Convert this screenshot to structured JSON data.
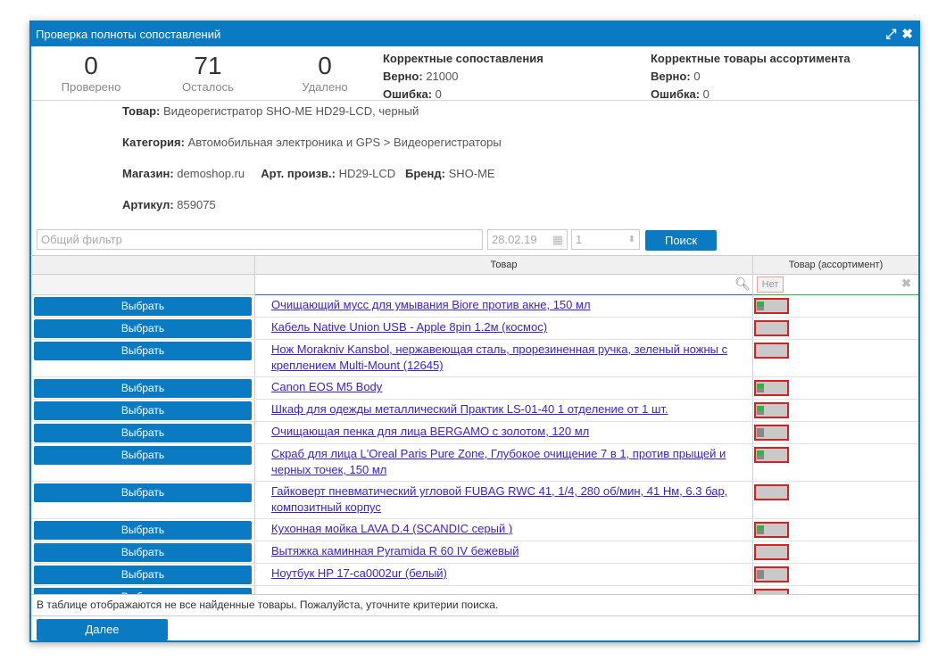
{
  "title": "Проверка полноты сопоставлений",
  "stats": [
    {
      "value": "0",
      "label": "Проверено"
    },
    {
      "value": "71",
      "label": "Осталось"
    },
    {
      "value": "0",
      "label": "Удалено"
    }
  ],
  "correct_matches": {
    "title": "Корректные сопоставления",
    "ok_label": "Верно:",
    "ok_value": "21000",
    "err_label": "Ошибка:",
    "err_value": "0"
  },
  "correct_assort": {
    "title": "Корректные товары ассортимента",
    "ok_label": "Верно:",
    "ok_value": "0",
    "err_label": "Ошибка:",
    "err_value": "0"
  },
  "product": {
    "label": "Товар:",
    "value": "Видеорегистратор SHO-ME HD29-LCD, черный",
    "category_label": "Категория:",
    "category_value": "Автомобильная электроника и GPS > Видеорегистраторы",
    "shop_label": "Магазин:",
    "shop_value": "demoshop.ru",
    "art_label": "Арт. произв.:",
    "art_value": "HD29-LCD",
    "brand_label": "Бренд:",
    "brand_value": "SHO-ME",
    "sku_label": "Артикул:",
    "sku_value": "859075"
  },
  "filter": {
    "placeholder": "Общий фильтр",
    "date": "28.02.19",
    "number": "1",
    "search_label": "Поиск"
  },
  "grid": {
    "col_product": "Товар",
    "col_assort": "Товар (ассортимент)",
    "assort_filter": "Нет",
    "select_label": "Выбрать",
    "rows": [
      {
        "name": "Очищающий мусс для умывания Biore против акне, 150 мл",
        "state": "green"
      },
      {
        "name": "Кабель Native Union USB - Apple 8pin 1.2м (космос)",
        "state": "none"
      },
      {
        "name": "Нож Morakniv Kansbol, нержавеющая сталь, прорезиненная ручка, зеленый ножны с креплением Multi-Mount (12645)",
        "state": "none"
      },
      {
        "name": "Canon EOS M5 Body",
        "state": "green"
      },
      {
        "name": "Шкаф для одежды металлический Практик LS-01-40 1 отделение от 1 шт.",
        "state": "green"
      },
      {
        "name": "Очищающая пенка для лица BERGAMO с золотом, 120 мл",
        "state": "gray"
      },
      {
        "name": "Скраб для лица L'Oreal Paris Pure Zone, Глубокое очищение 7 в 1, против прыщей и черных точек, 150 мл",
        "state": "green"
      },
      {
        "name": "Гайковерт пневматический угловой FUBAG RWC 41, 1/4, 280 об/мин, 41 Нм, 6.3 бар, композитный корпус",
        "state": "none"
      },
      {
        "name": "Кухонная мойка LAVA D.4 (SCANDIC серый )",
        "state": "green"
      },
      {
        "name": "Вытяжка каминная Pyramida R 60 IV бежевый",
        "state": "none"
      },
      {
        "name": "Ноутбук HP 17-ca0002ur (белый)",
        "state": "gray"
      }
    ]
  },
  "footnote": "В таблице отображаются не все найденные товары. Пожалуйста, уточните критерии поиска.",
  "next_label": "Далее"
}
